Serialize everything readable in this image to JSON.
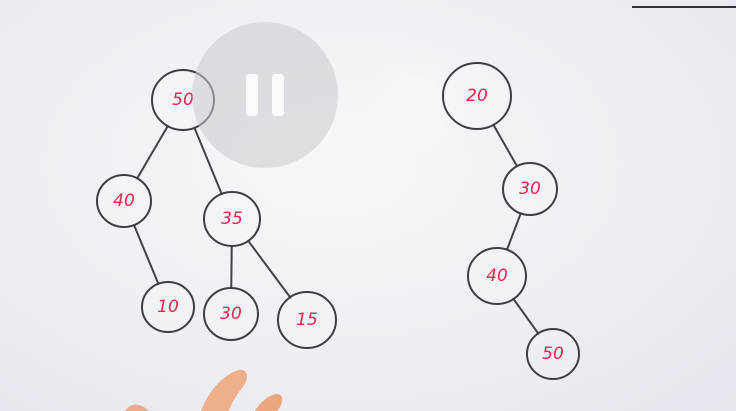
{
  "trees": [
    {
      "name": "left-tree",
      "nodes": [
        {
          "id": "n50",
          "label": "50"
        },
        {
          "id": "n40",
          "label": "40"
        },
        {
          "id": "n35",
          "label": "35"
        },
        {
          "id": "n10",
          "label": "10"
        },
        {
          "id": "n30",
          "label": "30"
        },
        {
          "id": "n15",
          "label": "15"
        }
      ],
      "edges": [
        [
          "n50",
          "n40"
        ],
        [
          "n50",
          "n35"
        ],
        [
          "n40",
          "n10"
        ],
        [
          "n35",
          "n30"
        ],
        [
          "n35",
          "n15"
        ]
      ]
    },
    {
      "name": "right-tree",
      "nodes": [
        {
          "id": "m20",
          "label": "20"
        },
        {
          "id": "m30",
          "label": "30"
        },
        {
          "id": "m40",
          "label": "40"
        },
        {
          "id": "m50",
          "label": "50"
        }
      ],
      "edges": [
        [
          "m20",
          "m30"
        ],
        [
          "m30",
          "m40"
        ],
        [
          "m40",
          "m50"
        ]
      ]
    }
  ],
  "player": {
    "state_icon": "pause-icon"
  },
  "colors": {
    "node_label": "#e8244a",
    "edge": "#3f4248",
    "board": "#eceef3"
  }
}
